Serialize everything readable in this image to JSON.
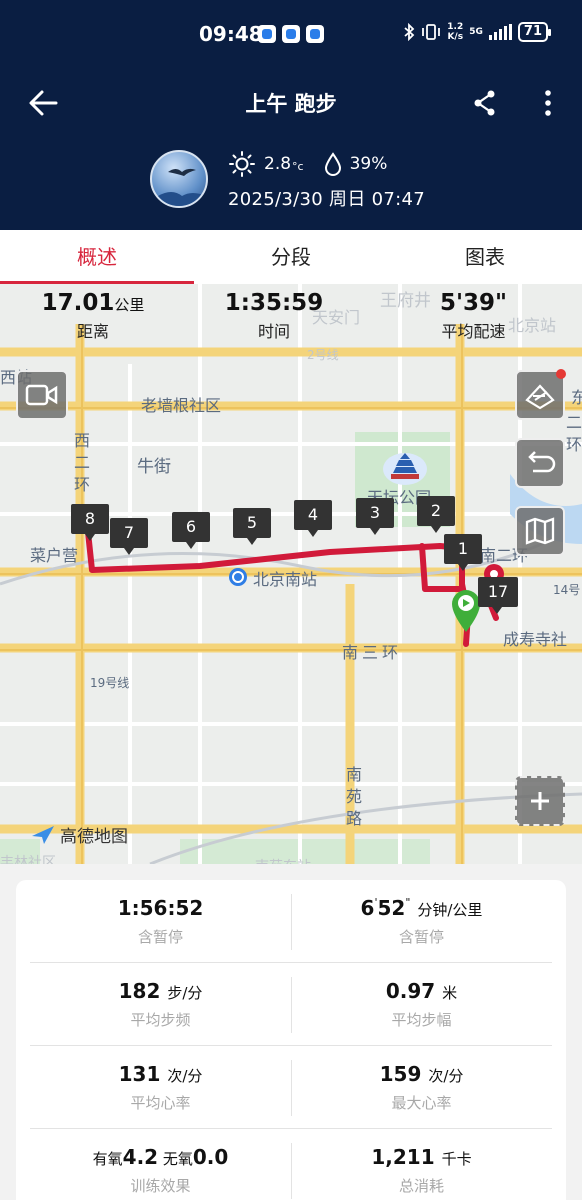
{
  "status_bar": {
    "time": "09:48",
    "net_speed_value": "1.2",
    "net_speed_unit": "K/s",
    "network": "5G",
    "battery": "71"
  },
  "header": {
    "title": "上午 跑步",
    "temperature": "2.8",
    "temperature_unit": "°c",
    "humidity": "39%",
    "datetime": "2025/3/30 周日 07:47"
  },
  "tabs": [
    {
      "label": "概述"
    },
    {
      "label": "分段"
    },
    {
      "label": "图表"
    }
  ],
  "summary": {
    "distance": {
      "value": "17.01",
      "unit": "公里",
      "label": "距离"
    },
    "time": {
      "value": "1:35:59",
      "label": "时间"
    },
    "pace": {
      "value": "5'39\"",
      "label": "平均配速"
    }
  },
  "map": {
    "labels": {
      "wangfujing": "王府井",
      "tiananmen": "天安门",
      "beijing_station": "北京站",
      "line2": "2号线",
      "xizhan": "西站",
      "laoqianggen": "老墙根社区",
      "dong": "东",
      "erhuan_right": "二环",
      "xierhuan": "西二环",
      "niujie": "牛街",
      "tiantan": "天坛公园",
      "caihuying": "菜户营",
      "south_station": "北京南站",
      "nan_erhuan": "南二环",
      "line14": "14号",
      "chengshousi": "成寿寺社",
      "nansanhuan": "南三环",
      "line19": "19号线",
      "nanyuanlu": "南苑路",
      "amap": "高德地图",
      "bottom_left": "丰林社区",
      "bottom_center": "南苑东站"
    },
    "km_markers": [
      "8",
      "7",
      "6",
      "5",
      "4",
      "3",
      "2",
      "1",
      "17"
    ],
    "route_color": "#d11a3a"
  },
  "stats": [
    {
      "left": {
        "value": "1:56:52",
        "unit": "",
        "label": "含暂停"
      },
      "right": {
        "value_main": "6",
        "value_sup1": "'",
        "value_mid": "52",
        "value_sup2": "\"",
        "unit": "分钟/公里",
        "label": "含暂停"
      }
    },
    {
      "left": {
        "value": "182",
        "unit": "步/分",
        "label": "平均步频"
      },
      "right": {
        "value": "0.97",
        "unit": "米",
        "label": "平均步幅"
      }
    },
    {
      "left": {
        "value": "131",
        "unit": "次/分",
        "label": "平均心率"
      },
      "right": {
        "value": "159",
        "unit": "次/分",
        "label": "最大心率"
      }
    },
    {
      "left": {
        "prefix1": "有氧",
        "value1": "4.2",
        "prefix2": " 无氧",
        "value2": "0.0",
        "label": "训练效果"
      },
      "right": {
        "value": "1,211",
        "unit": "千卡",
        "label": "总消耗"
      }
    }
  ]
}
